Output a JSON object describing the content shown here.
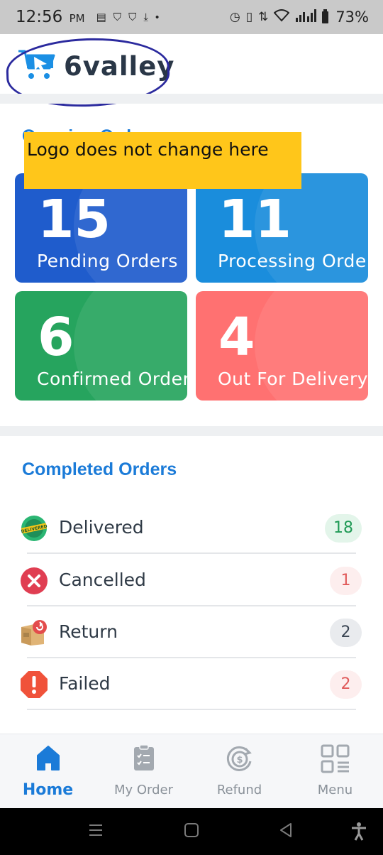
{
  "status_bar": {
    "time": "12:56",
    "ampm": "PM",
    "battery": "73%"
  },
  "header": {
    "logo_text": "6valley"
  },
  "ongoing": {
    "title": "Ongoing Orders",
    "annotation": "Logo does not change here",
    "cards": [
      {
        "count": "15",
        "label": "Pending Orders"
      },
      {
        "count": "11",
        "label": "Processing Orders"
      },
      {
        "count": "6",
        "label": "Confirmed Orders"
      },
      {
        "count": "4",
        "label": "Out For Delivery"
      }
    ]
  },
  "completed": {
    "title": "Completed Orders",
    "items": [
      {
        "label": "Delivered",
        "count": "18"
      },
      {
        "label": "Cancelled",
        "count": "1"
      },
      {
        "label": "Return",
        "count": "2"
      },
      {
        "label": "Failed",
        "count": "2"
      }
    ]
  },
  "bottom_nav": [
    {
      "label": "Home",
      "icon": "home-icon"
    },
    {
      "label": "My Order",
      "icon": "clipboard-icon"
    },
    {
      "label": "Refund",
      "icon": "refund-icon"
    },
    {
      "label": "Menu",
      "icon": "menu-grid-icon"
    }
  ],
  "colors": {
    "primary": "#1b7bd8",
    "pending": "#1f5ccc",
    "processing": "#1a8ddc",
    "confirmed": "#26a45e",
    "out_for_delivery": "#ff7171",
    "annotation": "#ffc61a"
  }
}
